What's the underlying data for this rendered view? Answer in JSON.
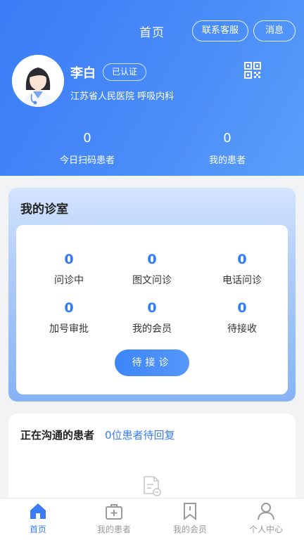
{
  "topbar": {
    "title": "首页",
    "service_label": "联系客服",
    "message_label": "消息"
  },
  "doctor": {
    "name": "李白",
    "verified": "已认证",
    "hospital": "江苏省人民医院 呼吸内科"
  },
  "stats": [
    {
      "value": "0",
      "label": "今日扫码患者"
    },
    {
      "value": "0",
      "label": "我的患者"
    }
  ],
  "clinic": {
    "title": "我的诊室",
    "cells": [
      {
        "value": "0",
        "label": "问诊中"
      },
      {
        "value": "0",
        "label": "图文问诊"
      },
      {
        "value": "0",
        "label": "电话问诊"
      },
      {
        "value": "0",
        "label": "加号审批"
      },
      {
        "value": "0",
        "label": "我的会员"
      },
      {
        "value": "0",
        "label": "待接收"
      }
    ],
    "pending_button": "待接诊"
  },
  "communicating": {
    "title": "正在沟通的患者",
    "count_text": "0位患者待回复"
  },
  "tabs": [
    {
      "label": "首页",
      "icon": "home-icon"
    },
    {
      "label": "我的患者",
      "icon": "medical-kit-icon"
    },
    {
      "label": "我的会员",
      "icon": "bookmark-icon"
    },
    {
      "label": "个人中心",
      "icon": "person-icon"
    }
  ],
  "colors": {
    "primary": "#3a7cf6",
    "tab_inactive": "#9a9a9a"
  }
}
